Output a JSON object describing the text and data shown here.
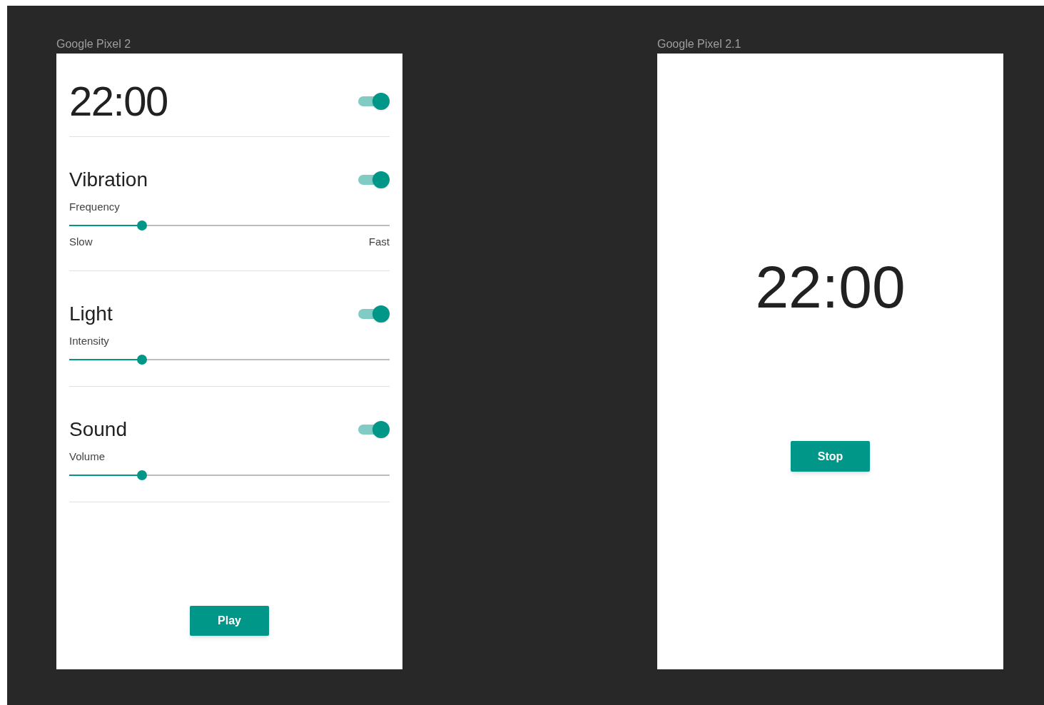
{
  "screens": [
    {
      "label": "Google Pixel 2",
      "time": "22:00",
      "alarm_on": true,
      "sections": [
        {
          "title": "Vibration",
          "on": true,
          "slider_label": "Frequency",
          "level": 0.228,
          "min_label": "Slow",
          "max_label": "Fast"
        },
        {
          "title": "Light",
          "on": true,
          "slider_label": "Intensity",
          "level": 0.228
        },
        {
          "title": "Sound",
          "on": true,
          "slider_label": "Volume",
          "level": 0.228
        }
      ],
      "button": "Play"
    },
    {
      "label": "Google Pixel 2.1",
      "time": "22:00",
      "button": "Stop"
    }
  ]
}
